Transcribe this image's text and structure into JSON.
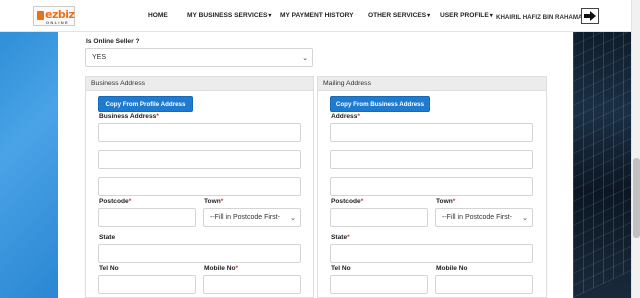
{
  "header": {
    "logo_text": "ezbiz",
    "logo_sub": "ONLINE",
    "nav": [
      {
        "label": "HOME",
        "has_caret": false
      },
      {
        "label": "MY BUSINESS SERVICES",
        "has_caret": true
      },
      {
        "label": "MY PAYMENT HISTORY",
        "has_caret": false
      },
      {
        "label": "OTHER SERVICES",
        "has_caret": true
      },
      {
        "label": "USER PROFILE",
        "has_caret": true
      }
    ],
    "user_name": "KHAIRIL HAFIZ BIN RAHAMAT",
    "logout_icon": "logout-arrow-icon",
    "caret": "▾"
  },
  "form": {
    "online_seller": {
      "label": "Is Online Seller ?",
      "value": "YES"
    },
    "business": {
      "title": "Business Address",
      "copy_button": "Copy From Profile Address",
      "address_label": "Business Address",
      "postcode_label": "Postcode",
      "town_label": "Town",
      "town_value": "--Fill in Postcode First-",
      "state_label": "State",
      "tel_label": "Tel No",
      "mobile_label": "Mobile No"
    },
    "mailing": {
      "title": "Mailing Address",
      "copy_button": "Copy From Business Address",
      "address_label": "Address",
      "postcode_label": "Postcode",
      "town_label": "Town",
      "town_value": "--Fill in Postcode First-",
      "state_label": "State",
      "tel_label": "Tel No",
      "mobile_label": "Mobile No"
    },
    "required_mark": "*"
  },
  "colors": {
    "accent": "#1f7bd0",
    "logo": "#e8711c",
    "required": "#d9342b"
  }
}
